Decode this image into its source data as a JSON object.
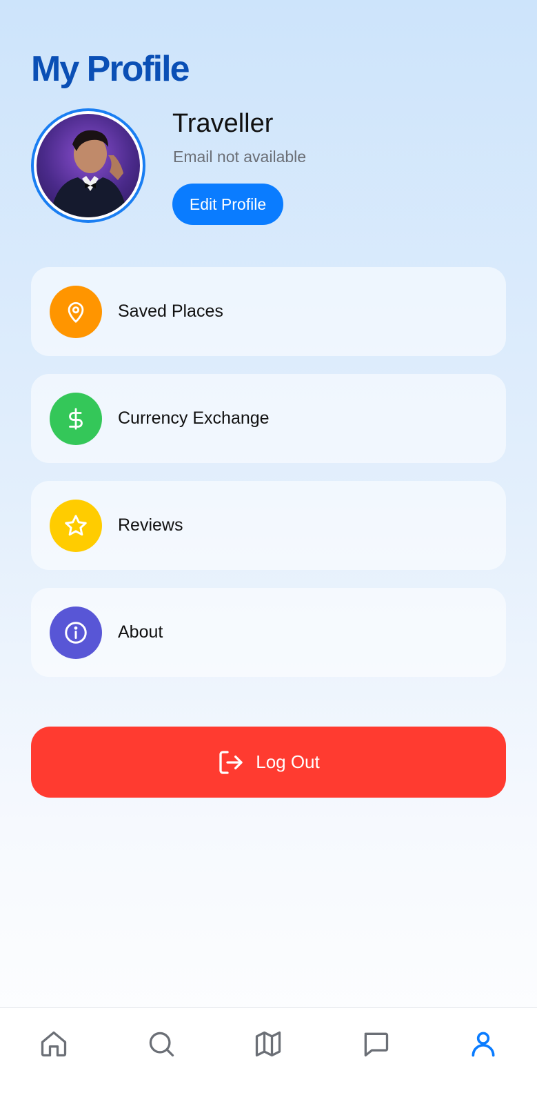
{
  "header": {
    "title": "My Profile"
  },
  "profile": {
    "name": "Traveller",
    "email": "Email not available",
    "edit_label": "Edit Profile"
  },
  "menu": [
    {
      "label": "Saved Places",
      "icon": "map-pin-icon",
      "color": "#ff9500"
    },
    {
      "label": "Currency Exchange",
      "icon": "dollar-icon",
      "color": "#34c759"
    },
    {
      "label": "Reviews",
      "icon": "star-icon",
      "color": "#ffcc00"
    },
    {
      "label": "About",
      "icon": "info-icon",
      "color": "#5856d6"
    }
  ],
  "logout": {
    "label": "Log Out",
    "color": "#ff3b30"
  },
  "nav": {
    "active": "profile",
    "active_color": "#0a7cff",
    "items": [
      "home-icon",
      "search-icon",
      "map-icon",
      "chat-icon",
      "profile-icon"
    ]
  }
}
